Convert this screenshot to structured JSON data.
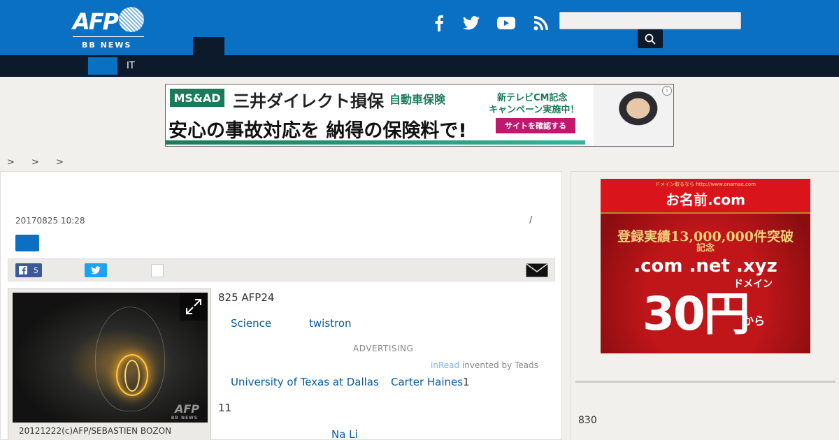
{
  "header": {
    "logo_text": "AFP",
    "logo_sub": "BB NEWS",
    "social": [
      "facebook-icon",
      "twitter-icon",
      "youtube-icon",
      "rss-icon"
    ],
    "search_value": "",
    "brand_color": "#0a70c3",
    "dark_color": "#0c1a2b"
  },
  "nav": {
    "items": [
      "IT"
    ]
  },
  "banner_ad": {
    "badge": "MS&AD",
    "brand": "三井ダイレクト損保",
    "product": "自動車保険",
    "campaign_line1": "新テレビCM記念",
    "campaign_line2": "キャンペーン実施中！",
    "headline": "安心の事故対応を 納得の保険料で!",
    "cta": "サイトを確認する"
  },
  "breadcrumb": [
    ">",
    ">",
    ">"
  ],
  "article": {
    "date": "20170825 10:28",
    "slash": "/",
    "share": {
      "facebook_count": "5"
    },
    "image": {
      "watermark": "AFP",
      "watermark_sub": "BB NEWS",
      "caption": "20121222(c)AFP/SEBASTIEN BOZON"
    },
    "lines": {
      "l1": "825 AFP24",
      "link_science": "Science",
      "link_twistron": "twistron",
      "advertising": "ADVERTISING",
      "inread": "inRead",
      "inread_rest": " invented by Teads",
      "link_utd": "University of Texas at Dallas",
      "link_carter": "Carter Haines",
      "num1": "1",
      "l11": "11",
      "link_nali": "Na Li"
    }
  },
  "sidebar": {
    "ad": {
      "sub": "ドメイン取るなら  http://www.onamae.com",
      "brand": "お名前.com",
      "registered": "登録実績13,000,000件突破",
      "kinen": "記念",
      "tlds": ".com .net .xyz",
      "domain": "ドメイン",
      "price": "30円",
      "kara": "から"
    },
    "text_830": "830"
  }
}
